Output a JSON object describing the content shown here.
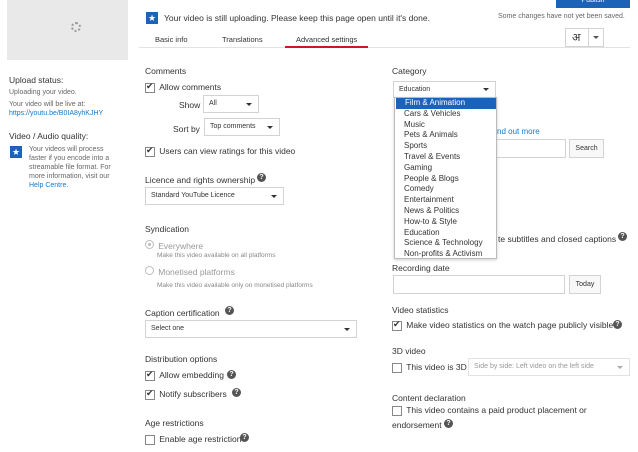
{
  "banner": {
    "message": "Your video is still uploading. Please keep this page open until it's done.",
    "saved_text": "Some changes have not yet been saved.",
    "publish_label": "Publish"
  },
  "tabs": [
    {
      "label": "Basic info"
    },
    {
      "label": "Translations"
    },
    {
      "label": "Advanced settings"
    }
  ],
  "lang_button": "अ",
  "sidebar": {
    "upload_status_title": "Upload status:",
    "uploading_text": "Uploading your video.",
    "live_at_text": "Your video will be live at:",
    "video_url": "https://youtu.be/B0IA8yhKJHY",
    "quality_title": "Video / Audio quality:",
    "quality_text_1": "Your videos will process",
    "quality_text_2": "faster if you encode into a",
    "quality_text_3": "streamable file format. For",
    "quality_text_4": "more information, visit our",
    "help_link": "Help Centre."
  },
  "comments": {
    "title": "Comments",
    "allow_label": "Allow comments",
    "show_label": "Show",
    "show_value": "All",
    "sortby_label": "Sort by",
    "sortby_value": "Top comments",
    "ratings_label": "Users can view ratings for this video"
  },
  "licence": {
    "title": "Licence and rights ownership",
    "value": "Standard YouTube Licence"
  },
  "syndication": {
    "title": "Syndication",
    "everywhere_label": "Everywhere",
    "everywhere_sub": "Make this video available on all platforms",
    "monetised_label": "Monetised platforms",
    "monetised_sub": "Make this video available only on monetised platforms"
  },
  "caption_cert": {
    "title": "Caption certification",
    "value": "Select one"
  },
  "distribution": {
    "title": "Distribution options",
    "embedding_label": "Allow embedding",
    "notify_label": "Notify subscribers"
  },
  "age": {
    "title": "Age restrictions",
    "enable_label": "Enable age restriction"
  },
  "category": {
    "title": "Category",
    "selected": "Education",
    "options": [
      "Film & Animation",
      "Cars & Vehicles",
      "Music",
      "Pets & Animals",
      "Sports",
      "Travel & Events",
      "Gaming",
      "People & Blogs",
      "Comedy",
      "Entertainment",
      "News & Politics",
      "How-to & Style",
      "Education",
      "Science & Technology",
      "Non-profits & Activism"
    ],
    "find_out_more": "nd out more",
    "search_label": "Search",
    "subtitles_partial": "te subtitles and closed captions"
  },
  "recording": {
    "title": "Recording date",
    "today_label": "Today"
  },
  "stats": {
    "title": "Video statistics",
    "label": "Make video statistics on the watch page publicly visible"
  },
  "video3d": {
    "title": "3D video",
    "label": "This video is 3D",
    "select_value": "Side by side: Left video on the left side"
  },
  "content_decl": {
    "title": "Content declaration",
    "label_1": "This video contains a paid product placement or",
    "label_2": "endorsement"
  }
}
